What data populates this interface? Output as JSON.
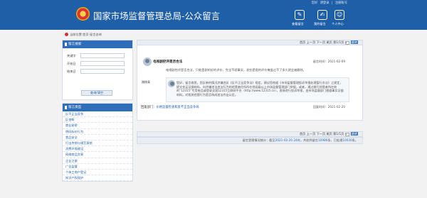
{
  "header": {
    "site_title": "国家市场监督管理总局-公众留言",
    "toplinks": [
      "您好",
      "请登录",
      "|",
      "注册账号"
    ],
    "actions": [
      {
        "label": "查看留言",
        "icon": "pencil-icon"
      },
      {
        "label": "我的留言",
        "icon": "notes-icon"
      },
      {
        "label": "个人中心",
        "icon": "user-icon"
      }
    ]
  },
  "breadcrumb": "当前位置:首页-留言咨询",
  "search": {
    "panel_title": "留言搜索",
    "keyword_label": "关键字",
    "start_label": "开始日",
    "end_label": "结束日",
    "button": "查询/清空"
  },
  "categories": {
    "panel_title": "留言类型",
    "items": [
      "反不正当竞争",
      "反垄断",
      "商业秘密",
      "明码标价行为",
      "食品安全",
      "打击传销与规范直销",
      "消费环境建设",
      "网络商品交易",
      "企业注册",
      "广告监督",
      "个体工商户登记",
      "知识产权保护"
    ]
  },
  "pager": {
    "text": "首页  上一页  下一页  尾页  第1/1页",
    "page_input": "1",
    "go": "跳转"
  },
  "message": {
    "title": "电视剧控评是否合法",
    "time": "留言时间：2021-02-09",
    "username": "路桃青",
    "content": "电视剧控评是否合法，只能是剧的好的评价，完全不顾事实，发些是假的评价掩盖过不了多久就会被删除。",
    "reply": "您好，留言收悉。您反映的情况涉嫌违反《反不正当竞争法》规定，建议您依据《市场监督管理投诉举报处理暂行办法》之规定，提交充足证据材料，向涉嫌违法违法行为的经营者住所所在地县级以上市场监督管理部门举报，或者，通过拨打经营者所在地的“12315”专用电话或登录全国12315互联网平台（http://www.12315.cn），直接进行投诉举报，由市场监督部门根据事实证据材料，对相关经营行为是否构成违法作出认定。",
    "reply_org_label": "回复部门：",
    "reply_org": "价格监督检查和反不正当竞争局",
    "reply_time": "回复时间：2021-02-20"
  },
  "stats": {
    "label_a": "留言受理情况统计：",
    "period_label": "截至",
    "period_value": "2021-02-20 24时",
    "received_label": "，共收到留言",
    "received_value": "10986",
    "mid": "条，已处理",
    "handled_value": "10030",
    "unit": "条。"
  },
  "colors": {
    "brand": "#1f5fa8",
    "panel": "#2e6db8"
  }
}
